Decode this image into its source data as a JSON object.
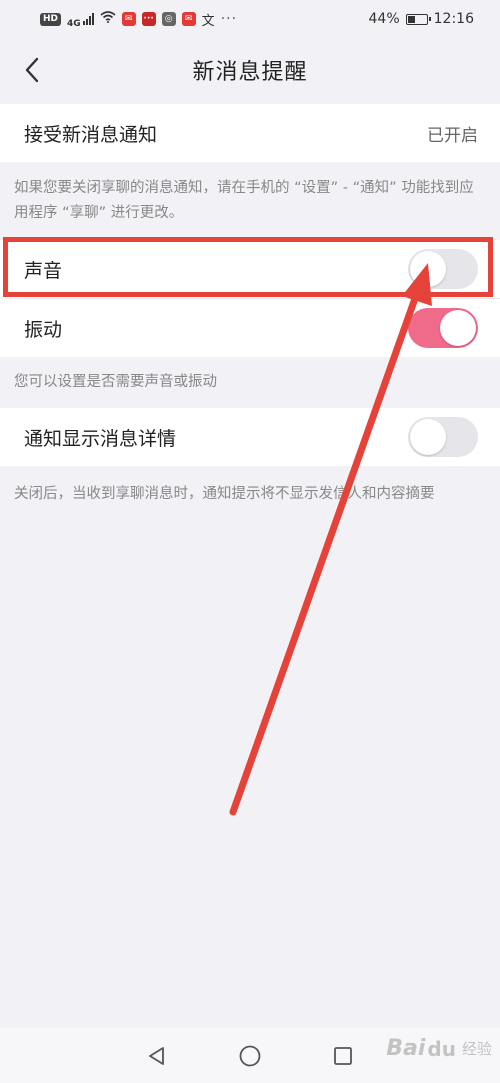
{
  "status_bar": {
    "hd": "HD",
    "network": "4G",
    "app_badge_1": "✉",
    "app_badge_2": "···",
    "app_badge_3": "◎",
    "app_badge_4": "✉",
    "app_badge_5": "文",
    "more": "···",
    "battery_percent": "44%",
    "battery_level": 0.44,
    "time": "12:16"
  },
  "header": {
    "title": "新消息提醒"
  },
  "settings": {
    "receive": {
      "label": "接受新消息通知",
      "value": "已开启"
    },
    "receive_hint": "如果您要关闭享聊的消息通知，请在手机的 “设置” - “通知” 功能找到应用程序 “享聊” 进行更改。",
    "sound": {
      "label": "声音",
      "on": false
    },
    "vibrate": {
      "label": "振动",
      "on": true
    },
    "sound_vibrate_hint": "您可以设置是否需要声音或振动",
    "show_details": {
      "label": "通知显示消息详情",
      "on": false
    },
    "show_details_hint": "关闭后，当收到享聊消息时，通知提示将不显示发信人和内容摘要"
  },
  "colors": {
    "accent_pink": "#f06a8a",
    "annotation_red": "#e5433a",
    "toggle_off": "#e6e6ea",
    "background": "#f2f1f6"
  },
  "watermark": {
    "brand": "Bai",
    "brand_tail": "经验",
    "paw": "du"
  },
  "icons": {
    "back": "chevron-left-icon",
    "nav_back": "triangle-back-icon",
    "nav_home": "circle-home-icon",
    "nav_recent": "square-recent-icon"
  }
}
